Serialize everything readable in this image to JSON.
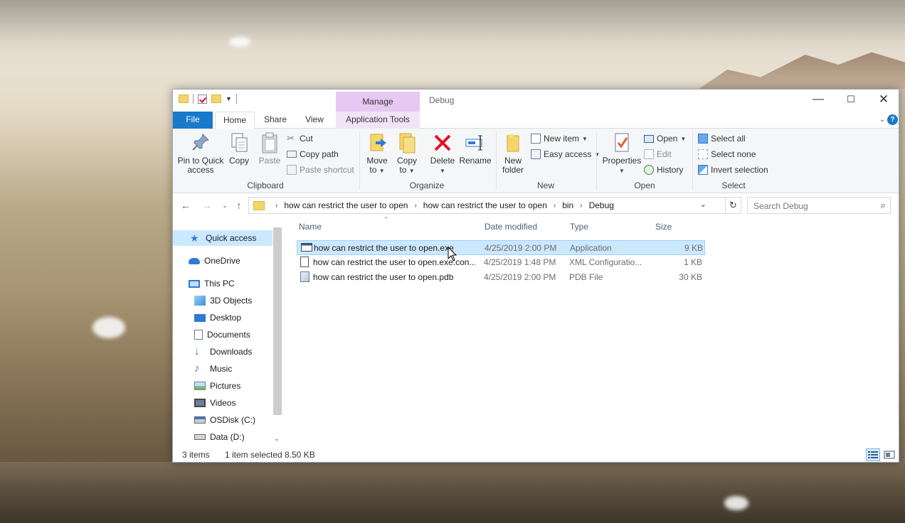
{
  "window": {
    "title": "Debug",
    "context_tab": "Manage",
    "controls": {
      "minimize": "—",
      "maximize": "☐",
      "close": "✕"
    }
  },
  "ribbon_tabs": {
    "file": "File",
    "home": "Home",
    "share": "Share",
    "view": "View",
    "application_tools": "Application Tools",
    "help": "?"
  },
  "ribbon": {
    "clipboard": {
      "label": "Clipboard",
      "pin_line1": "Pin to Quick",
      "pin_line2": "access",
      "copy": "Copy",
      "paste": "Paste",
      "cut": "Cut",
      "copy_path": "Copy path",
      "paste_shortcut": "Paste shortcut"
    },
    "organize": {
      "label": "Organize",
      "move_line1": "Move",
      "move_line2": "to",
      "copy_line1": "Copy",
      "copy_line2": "to",
      "delete": "Delete",
      "rename": "Rename"
    },
    "new": {
      "label": "New",
      "new_folder_line1": "New",
      "new_folder_line2": "folder",
      "new_item": "New item",
      "easy_access": "Easy access"
    },
    "open": {
      "label": "Open",
      "properties": "Properties",
      "open": "Open",
      "edit": "Edit",
      "history": "History"
    },
    "select": {
      "label": "Select",
      "select_all": "Select all",
      "select_none": "Select none",
      "invert_selection": "Invert selection"
    }
  },
  "address": {
    "breadcrumbs": [
      "how can restrict the user to open",
      "how can restrict the user to open",
      "bin",
      "Debug"
    ],
    "search_placeholder": "Search Debug"
  },
  "nav_pane": {
    "items": [
      {
        "label": "Quick access",
        "icon": "star-icon"
      },
      {
        "label": "OneDrive",
        "icon": "cloud-icon"
      },
      {
        "label": "This PC",
        "icon": "computer-icon"
      },
      {
        "label": "3D Objects",
        "icon": "cube-icon"
      },
      {
        "label": "Desktop",
        "icon": "desktop-icon"
      },
      {
        "label": "Documents",
        "icon": "document-icon"
      },
      {
        "label": "Downloads",
        "icon": "download-icon"
      },
      {
        "label": "Music",
        "icon": "music-icon"
      },
      {
        "label": "Pictures",
        "icon": "picture-icon"
      },
      {
        "label": "Videos",
        "icon": "video-icon"
      },
      {
        "label": "OSDisk (C:)",
        "icon": "drive-icon"
      },
      {
        "label": "Data (D:)",
        "icon": "drive-icon"
      }
    ]
  },
  "file_list": {
    "columns": {
      "name": "Name",
      "date": "Date modified",
      "type": "Type",
      "size": "Size"
    },
    "rows": [
      {
        "name": "how can restrict the user to open.exe",
        "date": "4/25/2019 2:00 PM",
        "type": "Application",
        "size": "9 KB",
        "selected": true
      },
      {
        "name": "how can restrict the user to open.exe.con...",
        "date": "4/25/2019 1:48 PM",
        "type": "XML Configuratio...",
        "size": "1 KB",
        "selected": false
      },
      {
        "name": "how can restrict the user to open.pdb",
        "date": "4/25/2019 2:00 PM",
        "type": "PDB File",
        "size": "30 KB",
        "selected": false
      }
    ]
  },
  "status_bar": {
    "item_count": "3 items",
    "selection": "1 item selected",
    "selection_size": "8.50 KB"
  },
  "colors": {
    "accent": "#1979ca",
    "selection_bg": "#cce8ff",
    "manage_tab": "#e7c8f3",
    "delete_red": "#e81123"
  }
}
